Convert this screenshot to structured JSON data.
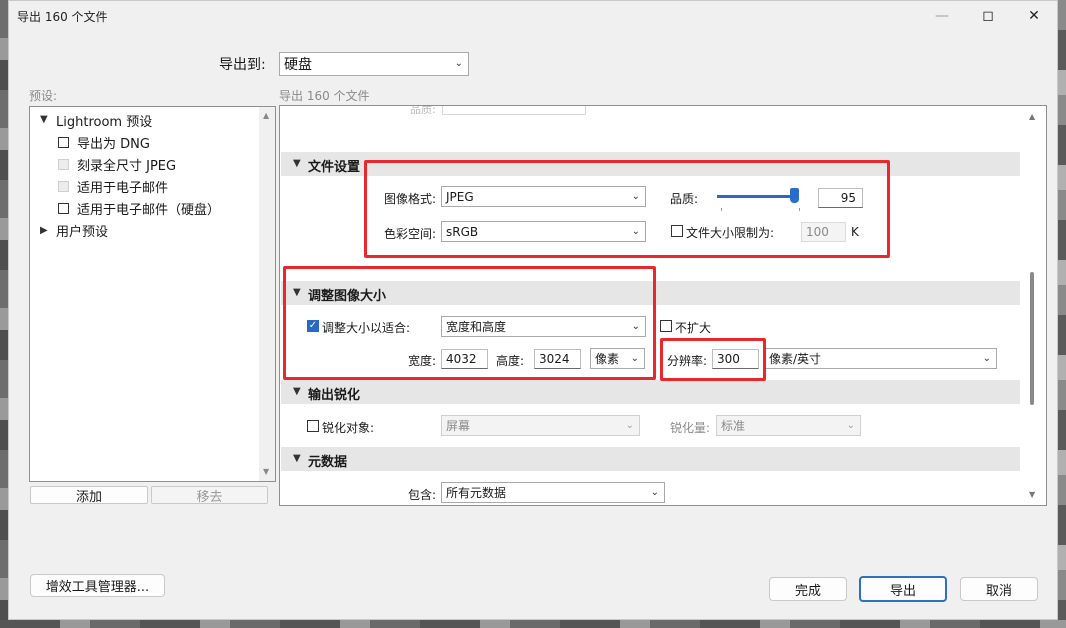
{
  "window": {
    "title": "导出 160 个文件",
    "minimize_icon": "minimize-icon",
    "maximize_icon": "maximize-icon",
    "close_icon": "close-icon"
  },
  "export_to": {
    "label": "导出到:",
    "value": "硬盘"
  },
  "presets": {
    "label": "预设:",
    "group_lightroom": "Lightroom 预设",
    "items": [
      {
        "label": "导出为 DNG"
      },
      {
        "label": "刻录全尺寸 JPEG"
      },
      {
        "label": "适用于电子邮件"
      },
      {
        "label": "适用于电子邮件（硬盘）"
      }
    ],
    "group_user": "用户预设",
    "add_button": "添加",
    "remove_button": "移去"
  },
  "content": {
    "header": "导出 160 个文件",
    "cut_text": "品质:",
    "file_settings": {
      "title": "文件设置",
      "format_label": "图像格式:",
      "format_value": "JPEG",
      "quality_label": "品质:",
      "quality_value": "95",
      "quality_level": 0.95,
      "colorspace_label": "色彩空间:",
      "colorspace_value": "sRGB",
      "limit_label": "文件大小限制为:",
      "limit_value": "100",
      "limit_unit": "K"
    },
    "resize": {
      "title": "调整图像大小",
      "fit_label": "调整大小以适合:",
      "fit_value": "宽度和高度",
      "no_enlarge_label": "不扩大",
      "width_label": "宽度:",
      "width_value": "4032",
      "height_label": "高度:",
      "height_value": "3024",
      "unit_value": "像素",
      "resolution_label": "分辨率:",
      "resolution_value": "300",
      "resolution_unit": "像素/英寸"
    },
    "sharpen": {
      "title": "输出锐化",
      "for_label": "锐化对象:",
      "for_value": "屏幕",
      "amount_label": "锐化量:",
      "amount_value": "标准"
    },
    "metadata": {
      "title": "元数据",
      "include_label": "包含:",
      "include_value": "所有元数据"
    }
  },
  "footer": {
    "plugin_manager": "增效工具管理器...",
    "done": "完成",
    "export": "导出",
    "cancel": "取消"
  },
  "colors": {
    "accent": "#2a68c8",
    "highlight_red": "#e8282a"
  }
}
